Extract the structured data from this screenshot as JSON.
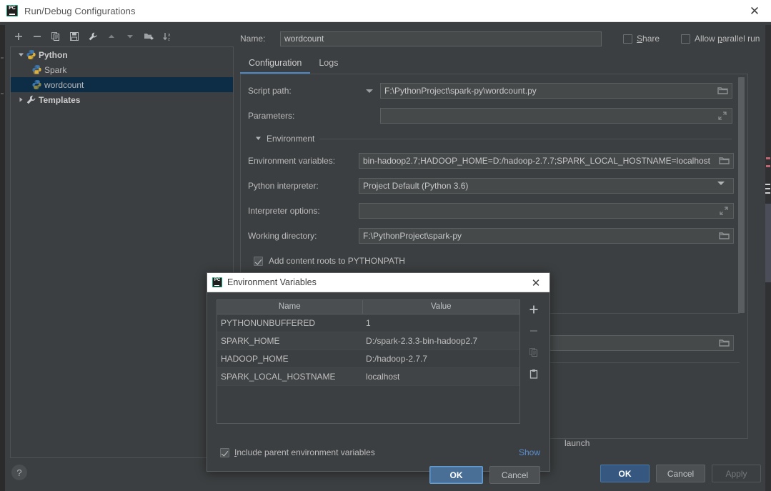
{
  "window": {
    "title": "Run/Debug Configurations",
    "close_label": "✕",
    "logo": "pycharm-logo"
  },
  "toolbar": {
    "buttons": [
      {
        "name": "add-configuration",
        "icon": "plus-icon"
      },
      {
        "name": "remove-configuration",
        "icon": "minus-icon"
      },
      {
        "name": "copy-configuration",
        "icon": "copy-icon"
      },
      {
        "name": "save-configuration",
        "icon": "save-icon"
      },
      {
        "name": "edit-templates",
        "icon": "wrench-icon"
      },
      {
        "name": "move-up",
        "icon": "arrow-up-icon"
      },
      {
        "name": "move-down",
        "icon": "arrow-down-icon"
      },
      {
        "name": "create-folder",
        "icon": "folder-add-icon"
      },
      {
        "name": "sort-configurations",
        "icon": "sort-az-icon"
      }
    ]
  },
  "tree": {
    "items": [
      {
        "label": "Python",
        "icon": "python-icon",
        "expanded": true,
        "bold": true,
        "level": 0
      },
      {
        "label": "Spark",
        "icon": "python-script-icon",
        "level": 1
      },
      {
        "label": "wordcount",
        "icon": "python-script-icon",
        "level": 1,
        "selected": true
      },
      {
        "label": "Templates",
        "icon": "wrench-icon",
        "expanded": false,
        "bold": true,
        "level": 0
      }
    ]
  },
  "form": {
    "name_label": "Name:",
    "name_value": "wordcount",
    "share_label": "Share",
    "share_checked": false,
    "allow_parallel_label": "Allow parallel run",
    "allow_parallel_checked": false,
    "tabs": [
      {
        "label": "Configuration",
        "active": true
      },
      {
        "label": "Logs",
        "active": false
      }
    ],
    "fields": [
      {
        "label": "Script path:",
        "value": "F:\\PythonProject\\spark-py\\wordcount.py",
        "icon": "folder-icon",
        "dropdown": true
      },
      {
        "label": "Parameters:",
        "value": "",
        "icon": "expand-icon",
        "dropdown": false
      },
      {
        "label": "Environment variables:",
        "value": "bin-hadoop2.7;HADOOP_HOME=D:/hadoop-2.7.7;SPARK_LOCAL_HOSTNAME=localhost",
        "icon": "folder-icon",
        "dropdown": false
      },
      {
        "label": "Python interpreter:",
        "value": "Project Default (Python 3.6)",
        "icon": "caret-down-icon",
        "dropdown": false
      },
      {
        "label": "Interpreter options:",
        "value": "",
        "icon": "expand-icon",
        "dropdown": false
      },
      {
        "label": "Working directory:",
        "value": "F:\\PythonProject\\spark-py",
        "icon": "folder-icon",
        "dropdown": false
      }
    ],
    "environment_section_label": "Environment",
    "add_content_roots_label": "Add content roots to PYTHONPATH",
    "add_content_roots_checked": true,
    "partial_background_text": "launch"
  },
  "footer": {
    "help_label": "?",
    "ok_label": "OK",
    "cancel_label": "Cancel",
    "apply_label": "Apply",
    "apply_disabled": true
  },
  "modal": {
    "title": "Environment Variables",
    "close_label": "✕",
    "columns": [
      "Name",
      "Value"
    ],
    "rows": [
      {
        "name": "PYTHONUNBUFFERED",
        "value": "1"
      },
      {
        "name": "SPARK_HOME",
        "value": "D:/spark-2.3.3-bin-hadoop2.7"
      },
      {
        "name": "HADOOP_HOME",
        "value": "D:/hadoop-2.7.7"
      },
      {
        "name": "SPARK_LOCAL_HOSTNAME",
        "value": "localhost"
      }
    ],
    "side_buttons": [
      {
        "name": "add-variable",
        "icon": "plus-icon",
        "enabled": true
      },
      {
        "name": "remove-variable",
        "icon": "minus-icon",
        "enabled": false
      },
      {
        "name": "copy-variable",
        "icon": "copy-icon",
        "enabled": false
      },
      {
        "name": "paste-variable",
        "icon": "paste-icon",
        "enabled": true
      }
    ],
    "include_parent_label": "Include parent environment variables",
    "include_parent_checked": true,
    "show_link_label": "Show",
    "ok_label": "OK",
    "cancel_label": "Cancel"
  },
  "colors": {
    "background": "#3c3f41",
    "panel_border": "#4e5254",
    "field_background": "#45494a",
    "selection": "#0d2c45",
    "accent": "#4a88c7",
    "link": "#5a8fd1",
    "primary_button": "#365880",
    "text": "#bbbbbb",
    "titlebar": "#ffffff"
  }
}
